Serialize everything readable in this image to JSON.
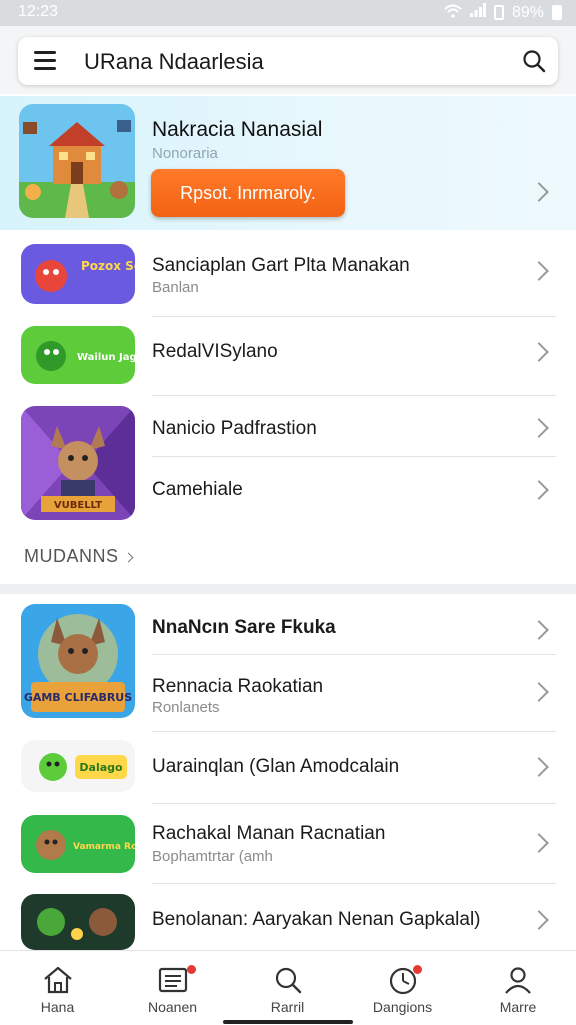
{
  "status": {
    "time": "12:23",
    "battery": "89%"
  },
  "header": {
    "title": "URana Ndaarlesia"
  },
  "featured": {
    "title": "Nakracia Nanasial",
    "subtitle": "Nonoraria",
    "button": "Rpsot. Inrmaroly."
  },
  "list1": [
    {
      "title": "Sanciaplan Gart Plta Manakan",
      "subtitle": "Banlan",
      "thumb_text": "Pozox Schuie"
    },
    {
      "title": "RedalVISylano",
      "subtitle": "",
      "thumb_text": "Wailun Jagila"
    },
    {
      "title": "Nanicio Padfrastion",
      "subtitle": ""
    },
    {
      "title": "Camehiale",
      "subtitle": "",
      "thumb_text": "VUBELLT"
    }
  ],
  "more_link": "MUDANNS",
  "list2": [
    {
      "title": "NnaNcın Sare Fkuka",
      "subtitle": ""
    },
    {
      "title": "Rennacia Raokatian",
      "subtitle": "Ronlanets",
      "thumb_text": "GAMB CLIFABRUS"
    },
    {
      "title": "Uarainqlan (Glan Amodcalain",
      "subtitle": "",
      "thumb_text": "Dalago"
    },
    {
      "title": "Rachakal Manan Racnatian",
      "subtitle": "Bophamtrtar (amh",
      "thumb_text": "Vamarma Rcau"
    },
    {
      "title": "Benolanan: Aaryakan Nenan Gapkalal)",
      "subtitle": ""
    }
  ],
  "tabs": [
    {
      "label": "Hana",
      "icon": "home-icon"
    },
    {
      "label": "Noanen",
      "icon": "list-icon"
    },
    {
      "label": "Rarril",
      "icon": "search-icon"
    },
    {
      "label": "Dangions",
      "icon": "clock-icon"
    },
    {
      "label": "Marre",
      "icon": "person-icon"
    }
  ],
  "colors": {
    "accent": "#f26313",
    "featured_bg": "#dff5fc",
    "badge": "#e53935"
  }
}
